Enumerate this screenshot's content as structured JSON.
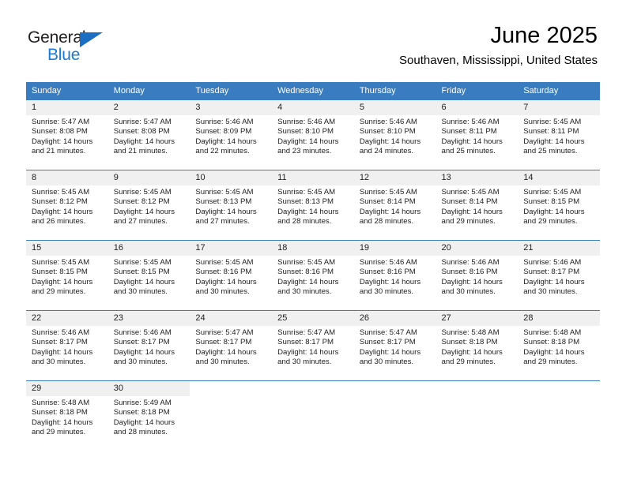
{
  "brand": {
    "name_primary": "General",
    "name_secondary": "Blue",
    "triangle_color": "#1b6ec2",
    "primary_color": "#231f20",
    "secondary_color": "#1b7ad1"
  },
  "header": {
    "month_title": "June 2025",
    "location": "Southaven, Mississippi, United States",
    "header_bg_color": "#3a7cc0",
    "daynum_bg_color": "#f0f0f0"
  },
  "weekday_headers": [
    "Sunday",
    "Monday",
    "Tuesday",
    "Wednesday",
    "Thursday",
    "Friday",
    "Saturday"
  ],
  "labels": {
    "sunrise_prefix": "Sunrise:",
    "sunset_prefix": "Sunset:",
    "daylight_prefix": "Daylight:"
  },
  "weeks": [
    [
      {
        "day": "1",
        "sunrise": "Sunrise: 5:47 AM",
        "sunset": "Sunset: 8:08 PM",
        "daylight_line1": "Daylight: 14 hours",
        "daylight_line2": "and 21 minutes."
      },
      {
        "day": "2",
        "sunrise": "Sunrise: 5:47 AM",
        "sunset": "Sunset: 8:08 PM",
        "daylight_line1": "Daylight: 14 hours",
        "daylight_line2": "and 21 minutes."
      },
      {
        "day": "3",
        "sunrise": "Sunrise: 5:46 AM",
        "sunset": "Sunset: 8:09 PM",
        "daylight_line1": "Daylight: 14 hours",
        "daylight_line2": "and 22 minutes."
      },
      {
        "day": "4",
        "sunrise": "Sunrise: 5:46 AM",
        "sunset": "Sunset: 8:10 PM",
        "daylight_line1": "Daylight: 14 hours",
        "daylight_line2": "and 23 minutes."
      },
      {
        "day": "5",
        "sunrise": "Sunrise: 5:46 AM",
        "sunset": "Sunset: 8:10 PM",
        "daylight_line1": "Daylight: 14 hours",
        "daylight_line2": "and 24 minutes."
      },
      {
        "day": "6",
        "sunrise": "Sunrise: 5:46 AM",
        "sunset": "Sunset: 8:11 PM",
        "daylight_line1": "Daylight: 14 hours",
        "daylight_line2": "and 25 minutes."
      },
      {
        "day": "7",
        "sunrise": "Sunrise: 5:45 AM",
        "sunset": "Sunset: 8:11 PM",
        "daylight_line1": "Daylight: 14 hours",
        "daylight_line2": "and 25 minutes."
      }
    ],
    [
      {
        "day": "8",
        "sunrise": "Sunrise: 5:45 AM",
        "sunset": "Sunset: 8:12 PM",
        "daylight_line1": "Daylight: 14 hours",
        "daylight_line2": "and 26 minutes."
      },
      {
        "day": "9",
        "sunrise": "Sunrise: 5:45 AM",
        "sunset": "Sunset: 8:12 PM",
        "daylight_line1": "Daylight: 14 hours",
        "daylight_line2": "and 27 minutes."
      },
      {
        "day": "10",
        "sunrise": "Sunrise: 5:45 AM",
        "sunset": "Sunset: 8:13 PM",
        "daylight_line1": "Daylight: 14 hours",
        "daylight_line2": "and 27 minutes."
      },
      {
        "day": "11",
        "sunrise": "Sunrise: 5:45 AM",
        "sunset": "Sunset: 8:13 PM",
        "daylight_line1": "Daylight: 14 hours",
        "daylight_line2": "and 28 minutes."
      },
      {
        "day": "12",
        "sunrise": "Sunrise: 5:45 AM",
        "sunset": "Sunset: 8:14 PM",
        "daylight_line1": "Daylight: 14 hours",
        "daylight_line2": "and 28 minutes."
      },
      {
        "day": "13",
        "sunrise": "Sunrise: 5:45 AM",
        "sunset": "Sunset: 8:14 PM",
        "daylight_line1": "Daylight: 14 hours",
        "daylight_line2": "and 29 minutes."
      },
      {
        "day": "14",
        "sunrise": "Sunrise: 5:45 AM",
        "sunset": "Sunset: 8:15 PM",
        "daylight_line1": "Daylight: 14 hours",
        "daylight_line2": "and 29 minutes."
      }
    ],
    [
      {
        "day": "15",
        "sunrise": "Sunrise: 5:45 AM",
        "sunset": "Sunset: 8:15 PM",
        "daylight_line1": "Daylight: 14 hours",
        "daylight_line2": "and 29 minutes."
      },
      {
        "day": "16",
        "sunrise": "Sunrise: 5:45 AM",
        "sunset": "Sunset: 8:15 PM",
        "daylight_line1": "Daylight: 14 hours",
        "daylight_line2": "and 30 minutes."
      },
      {
        "day": "17",
        "sunrise": "Sunrise: 5:45 AM",
        "sunset": "Sunset: 8:16 PM",
        "daylight_line1": "Daylight: 14 hours",
        "daylight_line2": "and 30 minutes."
      },
      {
        "day": "18",
        "sunrise": "Sunrise: 5:45 AM",
        "sunset": "Sunset: 8:16 PM",
        "daylight_line1": "Daylight: 14 hours",
        "daylight_line2": "and 30 minutes."
      },
      {
        "day": "19",
        "sunrise": "Sunrise: 5:46 AM",
        "sunset": "Sunset: 8:16 PM",
        "daylight_line1": "Daylight: 14 hours",
        "daylight_line2": "and 30 minutes."
      },
      {
        "day": "20",
        "sunrise": "Sunrise: 5:46 AM",
        "sunset": "Sunset: 8:16 PM",
        "daylight_line1": "Daylight: 14 hours",
        "daylight_line2": "and 30 minutes."
      },
      {
        "day": "21",
        "sunrise": "Sunrise: 5:46 AM",
        "sunset": "Sunset: 8:17 PM",
        "daylight_line1": "Daylight: 14 hours",
        "daylight_line2": "and 30 minutes."
      }
    ],
    [
      {
        "day": "22",
        "sunrise": "Sunrise: 5:46 AM",
        "sunset": "Sunset: 8:17 PM",
        "daylight_line1": "Daylight: 14 hours",
        "daylight_line2": "and 30 minutes."
      },
      {
        "day": "23",
        "sunrise": "Sunrise: 5:46 AM",
        "sunset": "Sunset: 8:17 PM",
        "daylight_line1": "Daylight: 14 hours",
        "daylight_line2": "and 30 minutes."
      },
      {
        "day": "24",
        "sunrise": "Sunrise: 5:47 AM",
        "sunset": "Sunset: 8:17 PM",
        "daylight_line1": "Daylight: 14 hours",
        "daylight_line2": "and 30 minutes."
      },
      {
        "day": "25",
        "sunrise": "Sunrise: 5:47 AM",
        "sunset": "Sunset: 8:17 PM",
        "daylight_line1": "Daylight: 14 hours",
        "daylight_line2": "and 30 minutes."
      },
      {
        "day": "26",
        "sunrise": "Sunrise: 5:47 AM",
        "sunset": "Sunset: 8:17 PM",
        "daylight_line1": "Daylight: 14 hours",
        "daylight_line2": "and 30 minutes."
      },
      {
        "day": "27",
        "sunrise": "Sunrise: 5:48 AM",
        "sunset": "Sunset: 8:18 PM",
        "daylight_line1": "Daylight: 14 hours",
        "daylight_line2": "and 29 minutes."
      },
      {
        "day": "28",
        "sunrise": "Sunrise: 5:48 AM",
        "sunset": "Sunset: 8:18 PM",
        "daylight_line1": "Daylight: 14 hours",
        "daylight_line2": "and 29 minutes."
      }
    ],
    [
      {
        "day": "29",
        "sunrise": "Sunrise: 5:48 AM",
        "sunset": "Sunset: 8:18 PM",
        "daylight_line1": "Daylight: 14 hours",
        "daylight_line2": "and 29 minutes."
      },
      {
        "day": "30",
        "sunrise": "Sunrise: 5:49 AM",
        "sunset": "Sunset: 8:18 PM",
        "daylight_line1": "Daylight: 14 hours",
        "daylight_line2": "and 28 minutes."
      },
      {
        "day": "",
        "sunrise": "",
        "sunset": "",
        "daylight_line1": "",
        "daylight_line2": ""
      },
      {
        "day": "",
        "sunrise": "",
        "sunset": "",
        "daylight_line1": "",
        "daylight_line2": ""
      },
      {
        "day": "",
        "sunrise": "",
        "sunset": "",
        "daylight_line1": "",
        "daylight_line2": ""
      },
      {
        "day": "",
        "sunrise": "",
        "sunset": "",
        "daylight_line1": "",
        "daylight_line2": ""
      },
      {
        "day": "",
        "sunrise": "",
        "sunset": "",
        "daylight_line1": "",
        "daylight_line2": ""
      }
    ]
  ]
}
